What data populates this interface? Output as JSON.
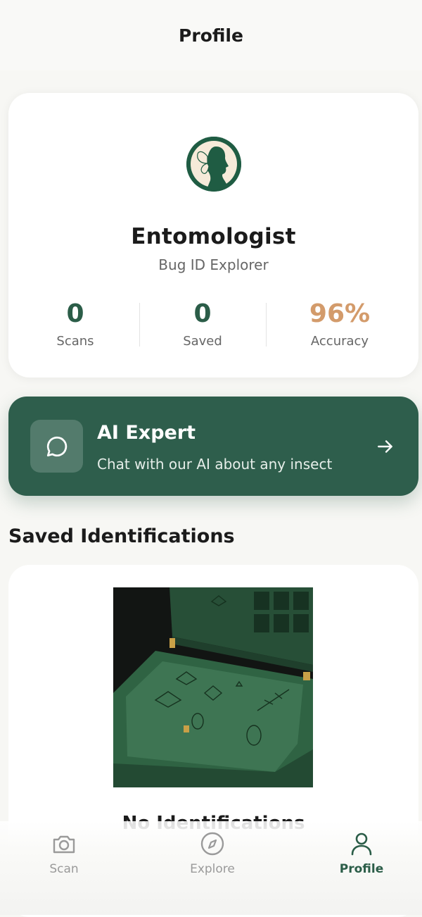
{
  "header": {
    "title": "Profile"
  },
  "profile": {
    "name": "Entomologist",
    "subtitle": "Bug ID Explorer",
    "stats": [
      {
        "value": "0",
        "label": "Scans"
      },
      {
        "value": "0",
        "label": "Saved"
      },
      {
        "value": "96%",
        "label": "Accuracy"
      }
    ]
  },
  "ai_expert": {
    "title": "AI Expert",
    "subtitle": "Chat with our AI about any insect",
    "icon": "chat-bubble-icon",
    "action_icon": "arrow-right-icon"
  },
  "saved": {
    "section_title": "Saved Identifications",
    "item_title": "No Identifications"
  },
  "tabs": [
    {
      "label": "Scan",
      "icon": "camera-icon",
      "active": false
    },
    {
      "label": "Explore",
      "icon": "compass-icon",
      "active": false
    },
    {
      "label": "Profile",
      "icon": "user-icon",
      "active": true
    }
  ],
  "colors": {
    "brand_green": "#2e5e4c",
    "accent_tan": "#d39b6b",
    "background": "#f7f7f4"
  }
}
